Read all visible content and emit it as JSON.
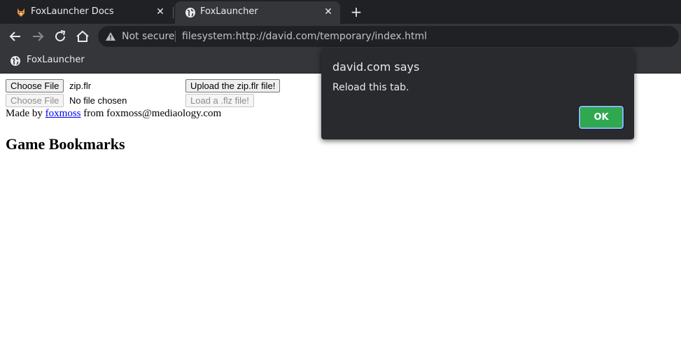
{
  "tabs": [
    {
      "title": "FoxLauncher Docs",
      "favicon": "fox-icon",
      "active": false
    },
    {
      "title": "FoxLauncher",
      "favicon": "globe-icon",
      "active": true
    }
  ],
  "toolbar": {
    "security_label": "Not secure",
    "url": "filesystem:http://david.com/temporary/index.html"
  },
  "bookmarks": [
    {
      "label": "FoxLauncher",
      "icon": "globe-icon"
    }
  ],
  "page": {
    "choose_file_label": "Choose File",
    "chosen_file_1": "zip.flr",
    "upload_button": "Upload the zip.flr file!",
    "choose_file_label_2": "Choose File",
    "chosen_file_2": "No file chosen",
    "load_button": "Load a .flz file!",
    "made_by_prefix": "Made by",
    "author_link": "foxmoss",
    "made_by_suffix": "from foxmoss@mediaology.com",
    "heading": "Game Bookmarks"
  },
  "dialog": {
    "title": "david.com says",
    "message": "Reload this tab.",
    "ok_label": "OK"
  },
  "colors": {
    "tabstrip_bg": "#202124",
    "toolbar_bg": "#35363a",
    "dialog_bg": "#292a2d",
    "ok_button": "#2fa84f",
    "link": "#0000ee"
  }
}
